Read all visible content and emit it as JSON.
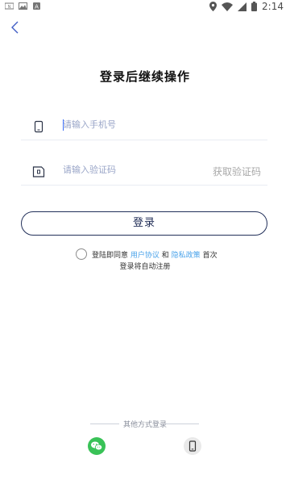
{
  "status_bar": {
    "time": "2:14",
    "left_icons": [
      "notification-icon",
      "image-icon",
      "app-icon"
    ],
    "right_icons": [
      "location-icon",
      "wifi-icon",
      "signal-icon",
      "battery-icon"
    ]
  },
  "nav": {
    "back_icon": "chevron-left-icon"
  },
  "title": "登录后继续操作",
  "phone_field": {
    "icon": "phone-icon",
    "placeholder": "请输入手机号",
    "value": ""
  },
  "code_field": {
    "icon": "sim-card-icon",
    "placeholder": "请输入验证码",
    "value": "",
    "get_code_label": "获取验证码"
  },
  "login_button": {
    "label": "登录"
  },
  "agreement": {
    "prefix": "登陆即同意",
    "user_agreement": "用户协议",
    "and": "和",
    "privacy_policy": "隐私政策",
    "suffix": "首次",
    "line2": "登录将自动注册",
    "checked": false
  },
  "other_login": {
    "label": "其他方式登录",
    "options": [
      {
        "name": "wechat",
        "icon": "wechat-icon",
        "color": "#39c257"
      },
      {
        "name": "phone",
        "icon": "phone-icon"
      }
    ]
  },
  "colors": {
    "accent_link": "#4aa3ea",
    "button_border": "#22305a",
    "wechat_green": "#39c257"
  }
}
